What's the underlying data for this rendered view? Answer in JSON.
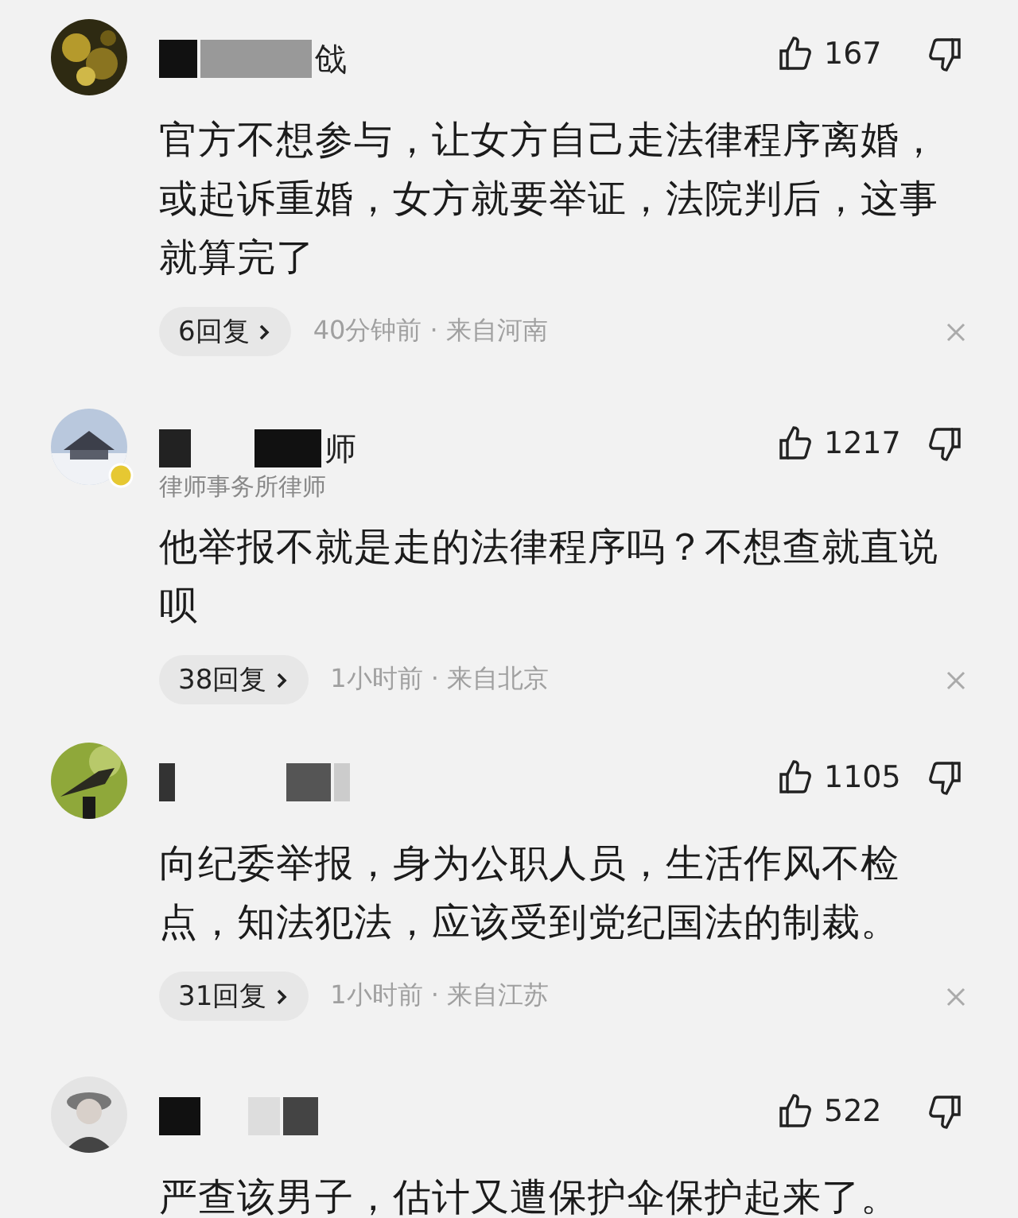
{
  "comments": [
    {
      "name": "戗",
      "likes": "167",
      "text": "官方不想参与，让女方自己走法律程序离婚，或起诉重婚，女方就要举证，法院判后，这事就算完了",
      "replies": "6回复",
      "meta": "40分钟前 · 来自河南",
      "verified": false
    },
    {
      "name": "师",
      "subtitle": "律师事务所律师",
      "likes": "1217",
      "text": "他举报不就是走的法律程序吗？不想查就直说呗",
      "replies": "38回复",
      "meta": "1小时前 · 来自北京",
      "verified": true
    },
    {
      "likes": "1105",
      "text": "向纪委举报，身为公职人员，生活作风不检点，知法犯法，应该受到党纪国法的制裁。",
      "replies": "31回复",
      "meta": "1小时前 · 来自江苏",
      "verified": false
    },
    {
      "likes": "522",
      "text": "严查该男子，估计又遭保护伞保护起来了。",
      "verified": false
    }
  ]
}
